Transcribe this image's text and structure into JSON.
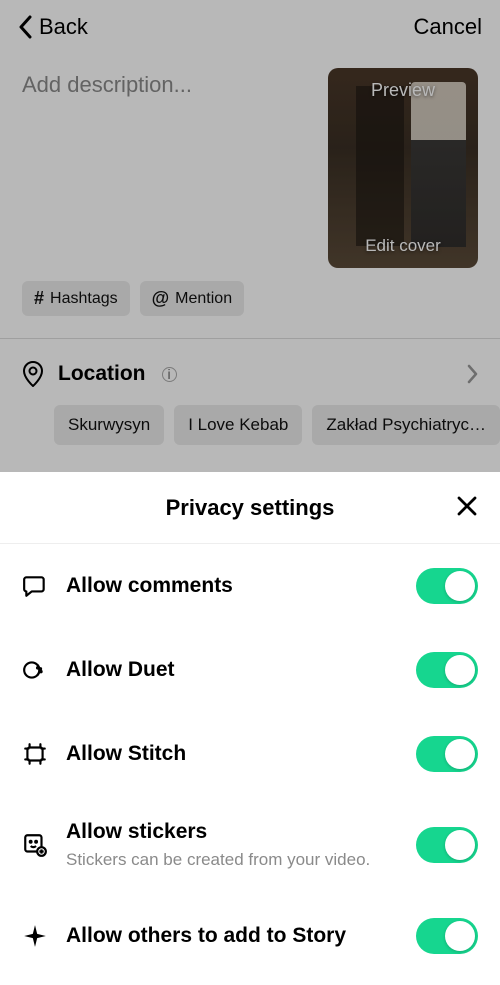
{
  "header": {
    "back": "Back",
    "cancel": "Cancel"
  },
  "compose": {
    "placeholder": "Add description...",
    "preview": "Preview",
    "edit_cover": "Edit cover",
    "chips": {
      "hashtags": "Hashtags",
      "mention": "Mention"
    }
  },
  "location": {
    "label": "Location",
    "suggestions": [
      "Skurwysyn",
      "I Love Kebab",
      "Zakład Psychiatryc…"
    ]
  },
  "sheet": {
    "title": "Privacy settings",
    "items": [
      {
        "label": "Allow comments",
        "sub": "",
        "on": true
      },
      {
        "label": "Allow Duet",
        "sub": "",
        "on": true
      },
      {
        "label": "Allow Stitch",
        "sub": "",
        "on": true
      },
      {
        "label": "Allow stickers",
        "sub": "Stickers can be created from your video.",
        "on": true
      },
      {
        "label": "Allow others to add to Story",
        "sub": "",
        "on": true
      }
    ]
  }
}
